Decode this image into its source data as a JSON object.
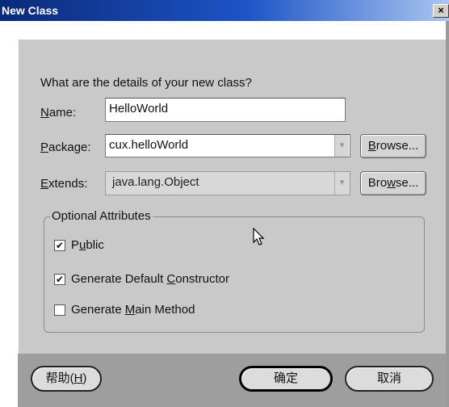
{
  "window": {
    "title": "New Class",
    "close_glyph": "×"
  },
  "heading": "What are the details of your new class?",
  "fields": {
    "name": {
      "label_u": "N",
      "label_rest": "ame:",
      "value": "HelloWorld"
    },
    "package": {
      "label_u": "P",
      "label_rest": "ackage:",
      "value": "cux.helloWorld",
      "browse_u": "B",
      "browse_rest": "rowse..."
    },
    "extends": {
      "label_u": "E",
      "label_rest": "xtends:",
      "value": "java.lang.Object",
      "browse_pre": "Bro",
      "browse_u": "w",
      "browse_rest": "se..."
    }
  },
  "optional": {
    "title": "Optional Attributes",
    "public": {
      "checked": true,
      "pre": "P",
      "u": "u",
      "rest": "blic"
    },
    "default_constructor": {
      "checked": true,
      "pre": "Generate Default ",
      "u": "C",
      "rest": "onstructor"
    },
    "main_method": {
      "checked": false,
      "pre": "Generate ",
      "u": "M",
      "rest": "ain Method"
    }
  },
  "buttons": {
    "help_pre": "帮助(",
    "help_u": "H",
    "help_post": ")",
    "ok": "确定",
    "cancel": "取消"
  },
  "check_glyph": "✔",
  "arrow_glyph": "▼"
}
